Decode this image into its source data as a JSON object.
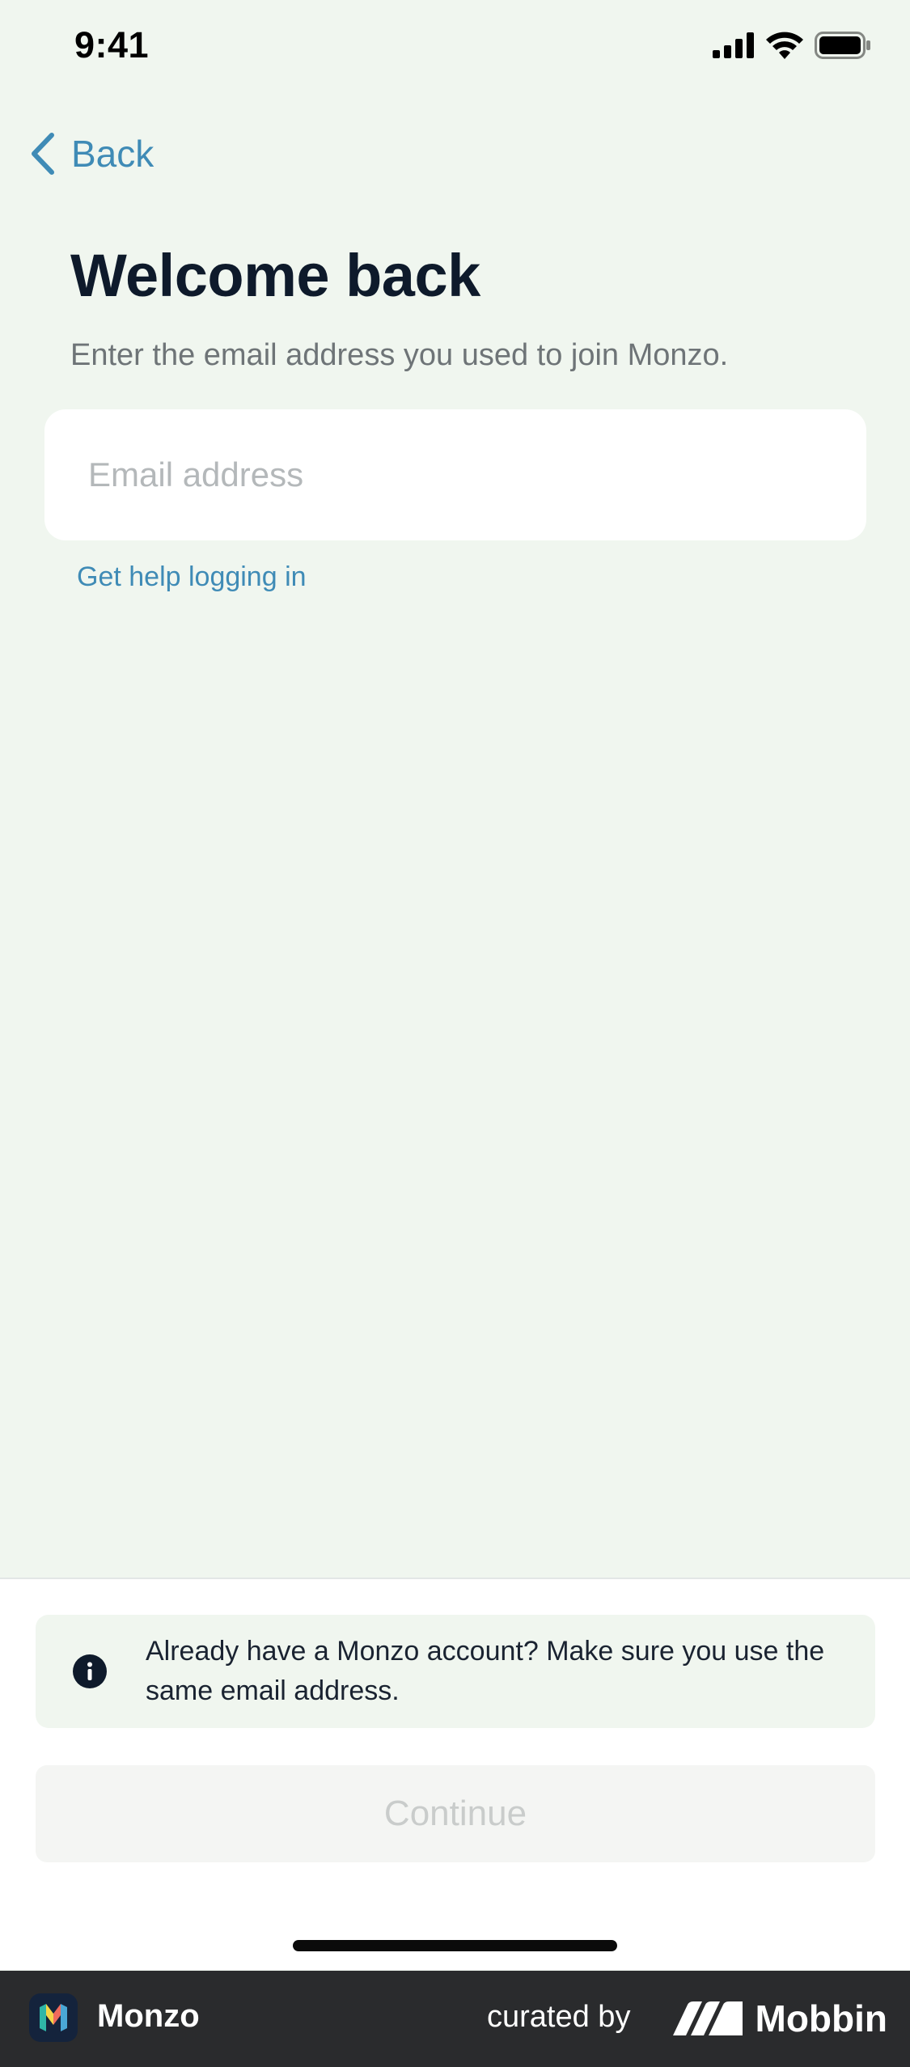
{
  "status_bar": {
    "time": "9:41",
    "icons": [
      "cellular-signal-icon",
      "wifi-icon",
      "battery-icon"
    ]
  },
  "nav": {
    "back_label": "Back",
    "back_icon": "chevron-left-icon"
  },
  "header": {
    "title": "Welcome back",
    "subtitle": "Enter the email address you used to join Monzo."
  },
  "form": {
    "email_placeholder": "Email address",
    "email_value": "",
    "help_link": "Get help logging in"
  },
  "notice": {
    "icon": "info-icon",
    "text": "Already have a Monzo account? Make sure you use the same email address."
  },
  "actions": {
    "continue_label": "Continue",
    "continue_enabled": false
  },
  "footer": {
    "app_name": "Monzo",
    "curated_by": "curated by",
    "brand": "Mobbin"
  },
  "colors": {
    "background": "#f0f6ef",
    "accent": "#3f8bb6",
    "title": "#0e1a2b",
    "disabled_button": "#f4f5f3",
    "footer": "#2a2b2d"
  }
}
